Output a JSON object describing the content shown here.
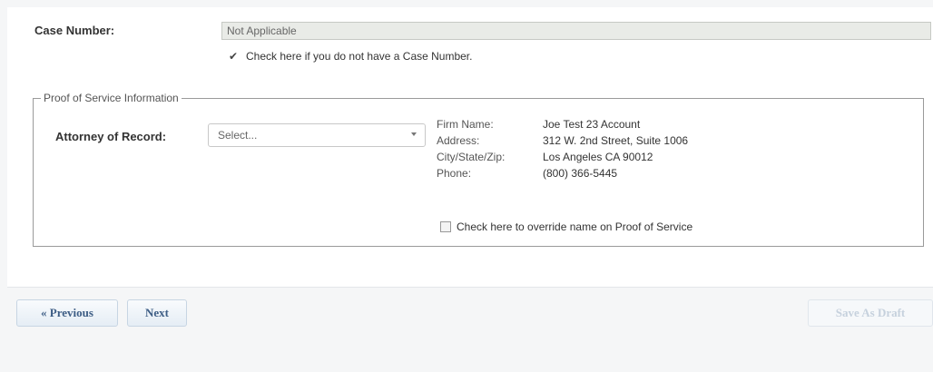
{
  "case": {
    "label": "Case Number:",
    "value": "Not Applicable",
    "checkbox_label": "Check here if you do not have a Case Number."
  },
  "proof_of_service": {
    "legend": "Proof of Service Information",
    "attorney_label": "Attorney of Record:",
    "attorney_select": "Select...",
    "firm_name_label": "Firm Name:",
    "firm_name": "Joe Test 23 Account",
    "address_label": "Address:",
    "address": "312 W. 2nd Street, Suite 1006",
    "city_label": "City/State/Zip:",
    "city": "Los Angeles CA 90012",
    "phone_label": "Phone:",
    "phone": "(800) 366-5445",
    "override_label": "Check here to override name on Proof of Service"
  },
  "nav": {
    "previous": "« Previous",
    "next": "Next",
    "save_draft": "Save As Draft"
  }
}
